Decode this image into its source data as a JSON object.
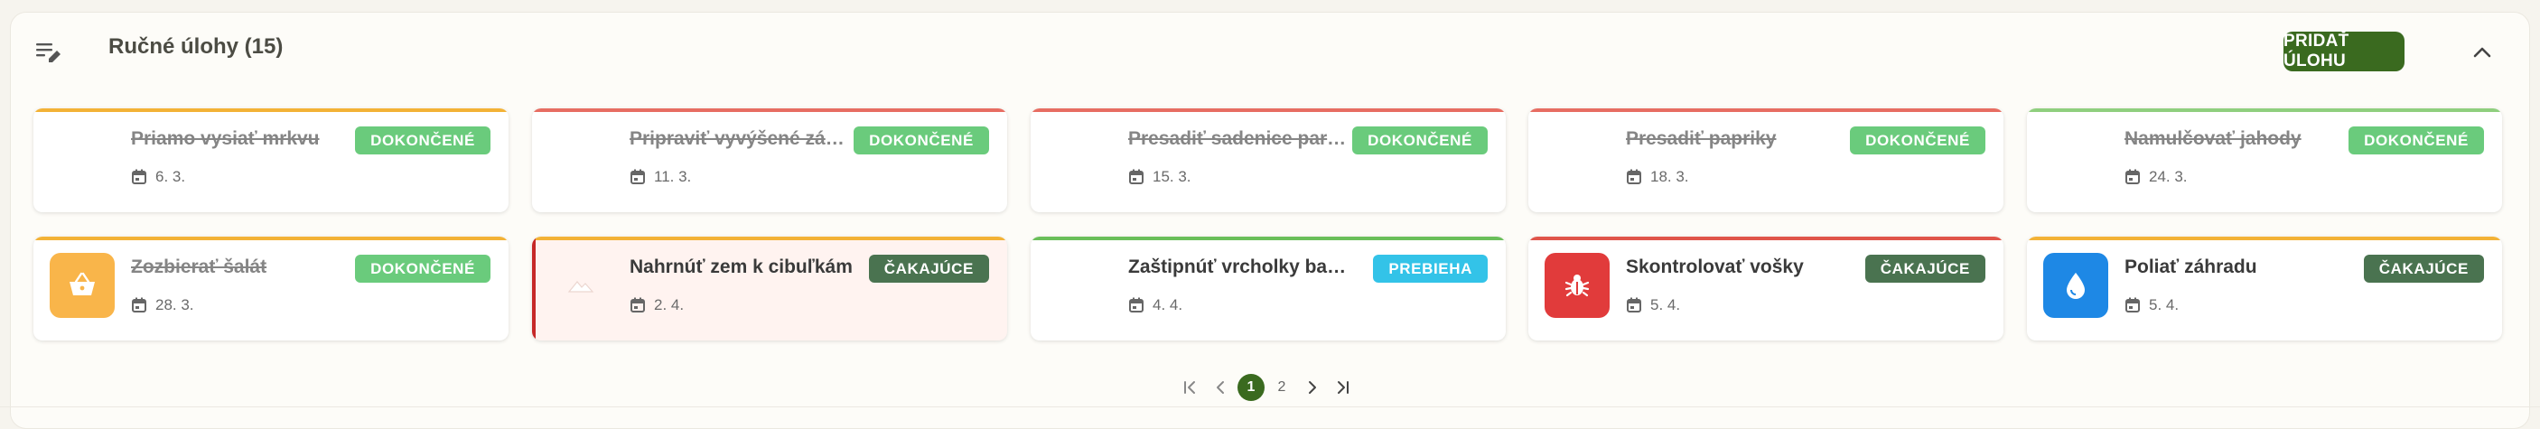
{
  "header": {
    "title": "Ručné úlohy (15)",
    "add_label": "PRIDAŤ ÚLOHU"
  },
  "colors": {
    "accent": "#3a6a1f",
    "done": "#6acb7c",
    "waiting": "#4a7350",
    "in_progress": "#33c3e8",
    "bar_orange": "#f3b236",
    "bar_red": "#e76d62",
    "bar_green": "#8fcf7e"
  },
  "tasks": [
    {
      "title": "Priamo vysiať mrkvu",
      "date": "6. 3.",
      "status": "DOKONČENÉ",
      "icon": "none"
    },
    {
      "title": "Pripraviť vyvýšené záhony",
      "date": "11. 3.",
      "status": "DOKONČENÉ",
      "icon": "none"
    },
    {
      "title": "Presadiť sadenice paradajok",
      "date": "15. 3.",
      "status": "DOKONČENÉ",
      "icon": "none"
    },
    {
      "title": "Presadiť papriky",
      "date": "18. 3.",
      "status": "DOKONČENÉ",
      "icon": "none"
    },
    {
      "title": "Namulčovať jahody",
      "date": "24. 3.",
      "status": "DOKONČENÉ",
      "icon": "none"
    },
    {
      "title": "Zozbierať šalát",
      "date": "28. 3.",
      "status": "DOKONČENÉ",
      "icon": "basket-icon"
    },
    {
      "title": "Nahrnúť zem k cibuľkám",
      "date": "2. 4.",
      "status": "ČAKAJÚCE",
      "icon": "mountain-icon"
    },
    {
      "title": "Zaštipnúť vrcholky bazalky",
      "date": "4. 4.",
      "status": "PREBIEHA",
      "icon": "none"
    },
    {
      "title": "Skontrolovať vošky",
      "date": "5. 4.",
      "status": "ČAKAJÚCE",
      "icon": "bug-icon"
    },
    {
      "title": "Poliať záhradu",
      "date": "5. 4.",
      "status": "ČAKAJÚCE",
      "icon": "water-drop-icon"
    }
  ],
  "pagination": {
    "pages": [
      "1",
      "2"
    ],
    "current": "1"
  }
}
